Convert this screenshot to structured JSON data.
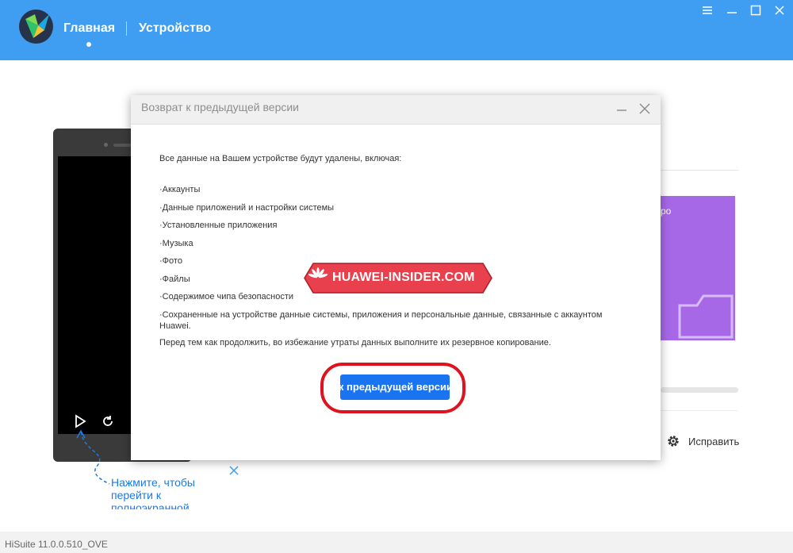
{
  "header": {
    "nav_home": "Главная",
    "nav_device": "Устройство"
  },
  "background": {
    "purple_card_text": "ро",
    "hint_text": "Нажмите, чтобы перейти к полноэкранной",
    "repair_label": "Исправить"
  },
  "dialog": {
    "title": "Возврат к предыдущей версии",
    "intro": "Все данные на Вашем устройстве будут удалены, включая:",
    "items": [
      "·Аккаунты",
      "·Данные приложений и настройки системы",
      "·Установленные приложения",
      "·Музыка",
      "·Фото",
      "·Файлы",
      "·Содержимое чипа безопасности",
      "·Сохраненные на устройстве данные системы, приложения и персональные данные, связанные с аккаунтом Huawei."
    ],
    "note": "Перед тем как продолжить, во избежание утраты данных выполните их резервное копирование.",
    "action_label": "Возврат к предыдущей версии"
  },
  "watermark": {
    "text": "HUAWEI-INSIDER.COM"
  },
  "footer": {
    "version": "HiSuite 11.0.0.510_OVE"
  },
  "colors": {
    "header": "#3f9ef1",
    "primary_button": "#1a73f0",
    "highlight_ring": "#e0121f",
    "watermark": "#e8404c",
    "purple_card": "#a768e8"
  }
}
